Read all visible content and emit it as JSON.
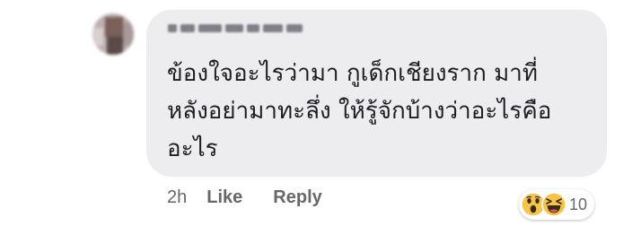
{
  "comment": {
    "text_lines": [
      "ข้องใจอะไรว่ามา กูเด็กเชียงราก มาที่",
      "หลังอย่ามาทะลึ่ง ให้รู้จักบ้างว่าอะไรคือ",
      "อะไร"
    ],
    "timestamp": "2h",
    "like_label": "Like",
    "reply_label": "Reply",
    "reaction_count": "10",
    "reaction_icons": [
      "wow-reaction-icon",
      "haha-reaction-icon"
    ]
  },
  "colors": {
    "bubble": "#ededf0",
    "text": "#1c1e21",
    "secondary_text": "#65676b"
  }
}
